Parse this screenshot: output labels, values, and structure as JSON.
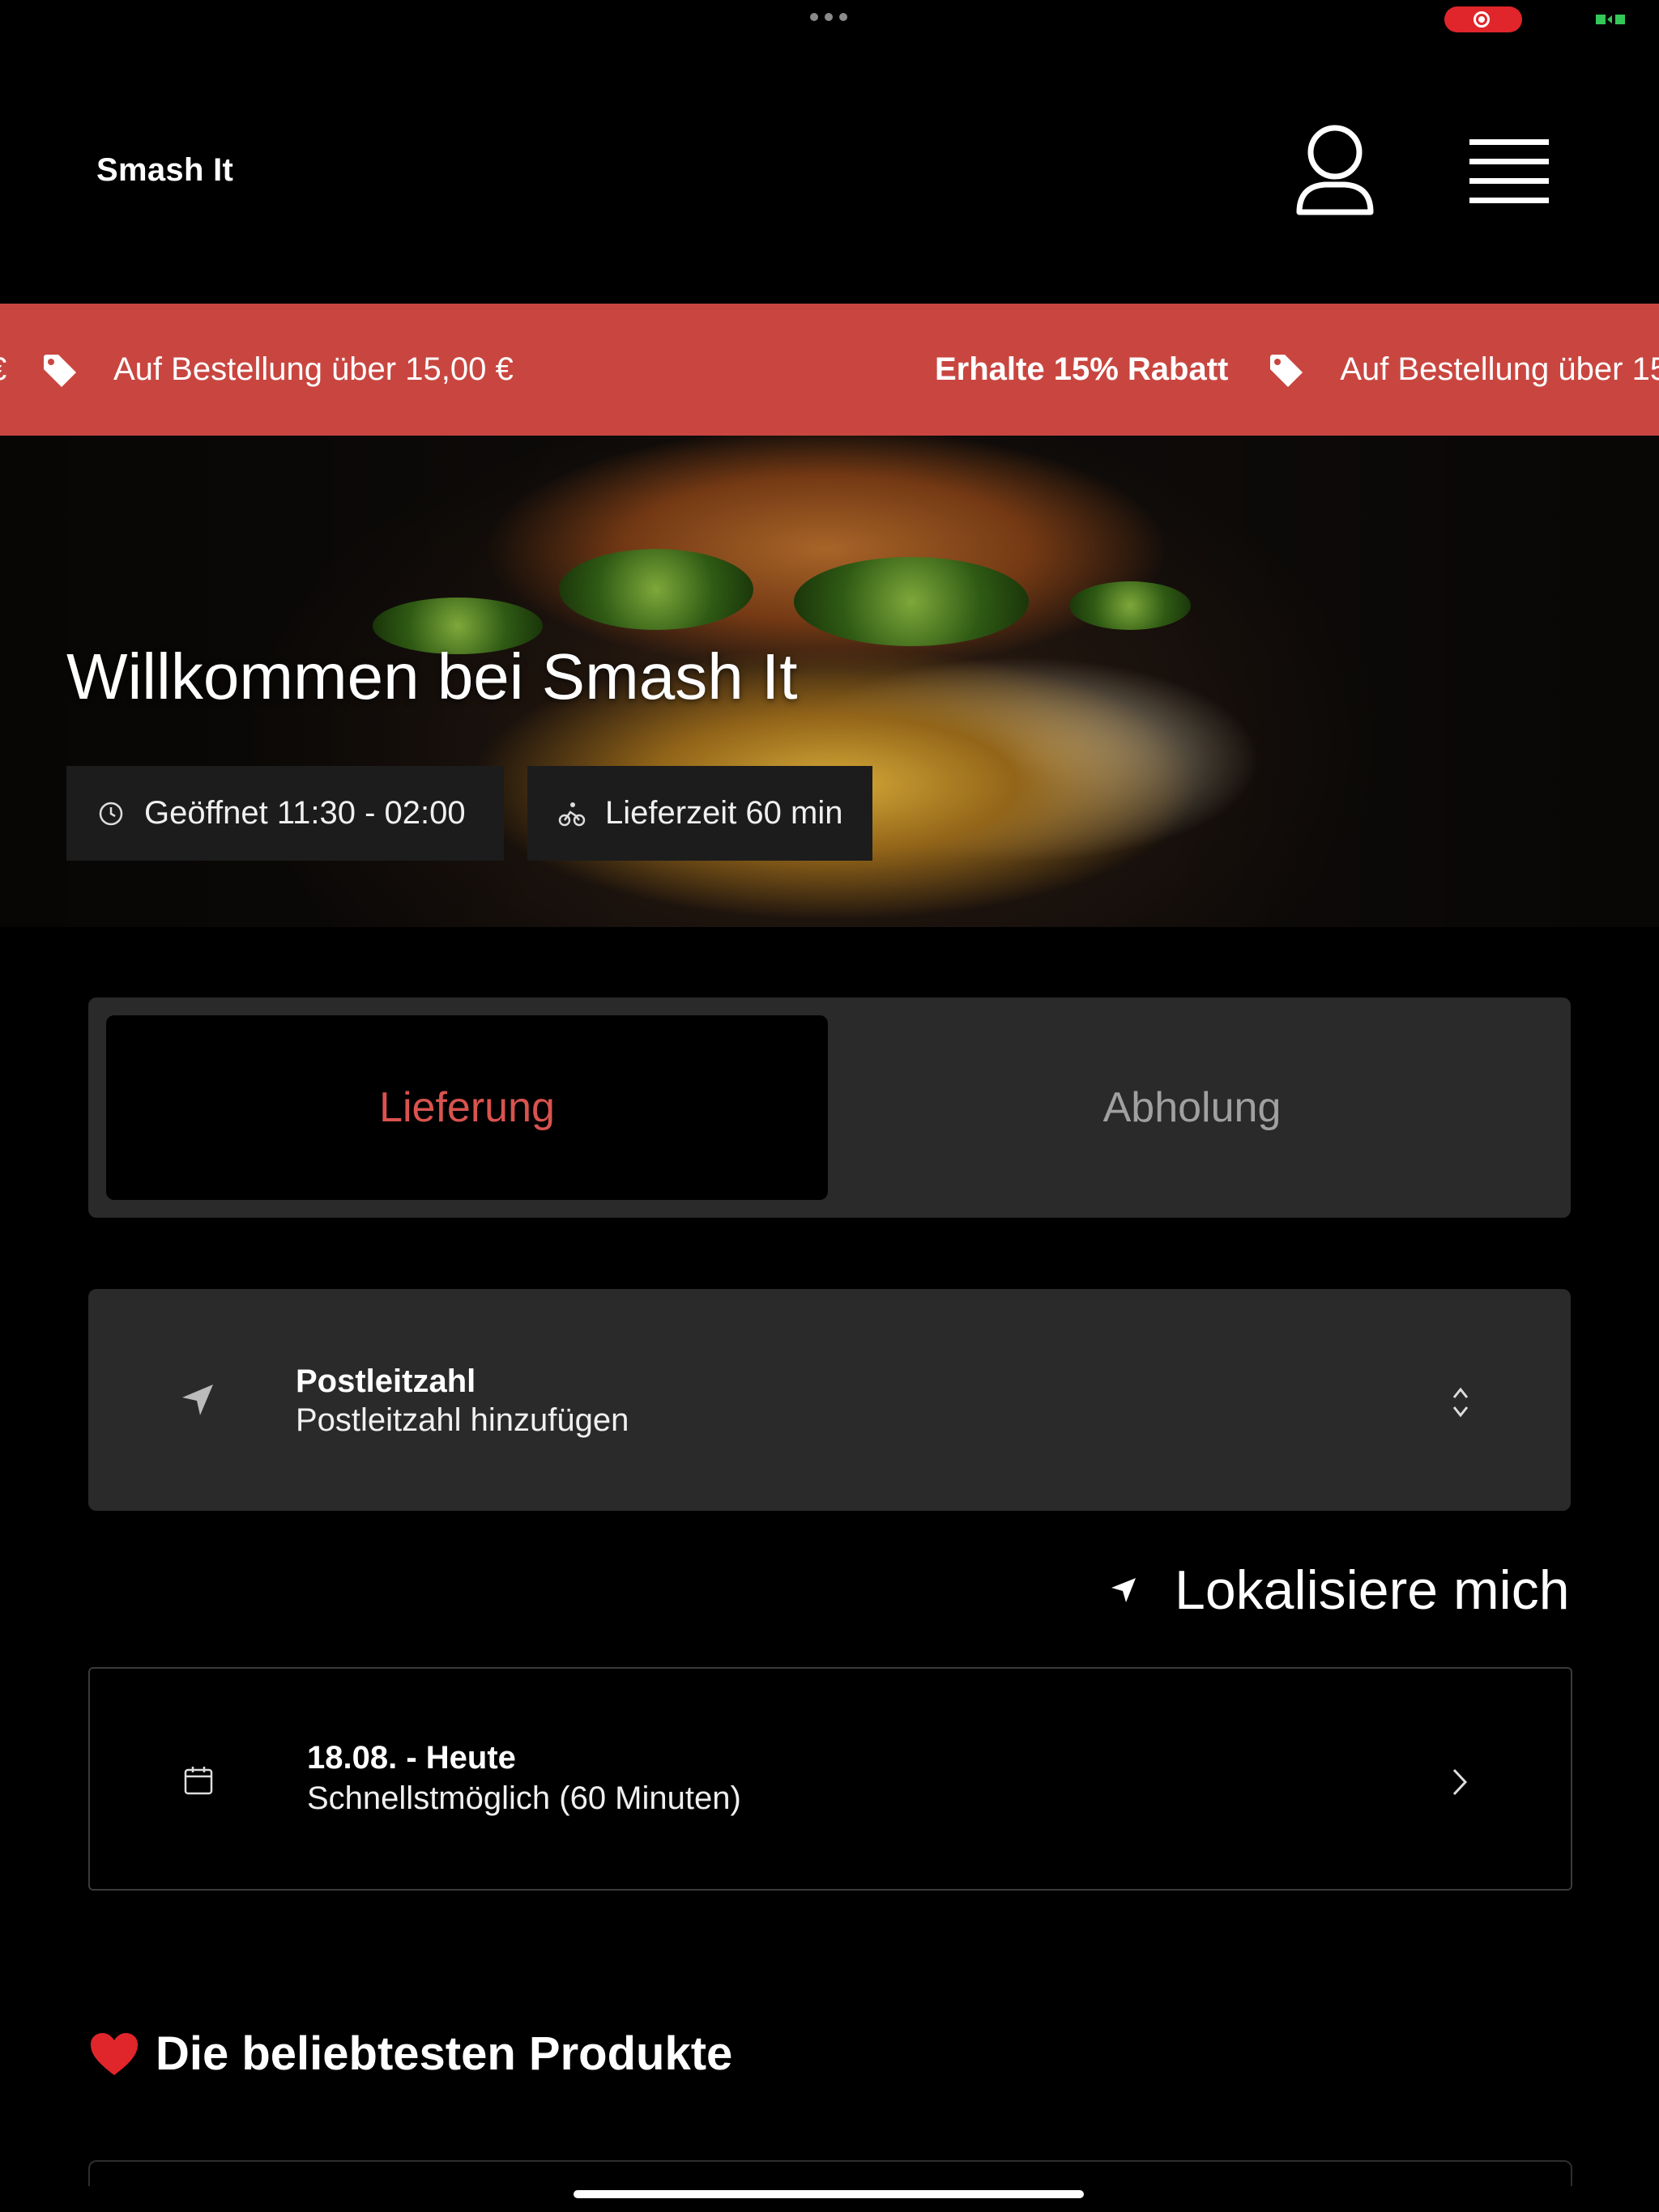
{
  "header": {
    "brand": "Smash It",
    "user_icon": "user-icon",
    "menu_icon": "hamburger-menu-icon"
  },
  "promo": {
    "text_condition": "Auf Bestellung über 15,00 €",
    "text_offer": "Erhalte 15% Rabatt",
    "text_condition_partial": "Auf Bestellung über 15",
    "icon": "tag-icon",
    "color": "#c94640"
  },
  "hero": {
    "title": "Willkommen bei Smash It",
    "hours": "Geöffnet 11:30 - 02:00",
    "delivery_time": "Lieferzeit 60 min"
  },
  "order_mode": {
    "delivery_label": "Lieferung",
    "pickup_label": "Abholung",
    "selected": "Lieferung",
    "accent_color": "#d9534f"
  },
  "postcode": {
    "title": "Postleitzahl",
    "placeholder": "Postleitzahl hinzufügen"
  },
  "locate": {
    "label": "Lokalisiere mich"
  },
  "delivery_date": {
    "date": "18.08. - Heute",
    "slot": "Schnellstmöglich (60 Minuten)"
  },
  "popular": {
    "title": "Die beliebtesten Produkte"
  }
}
